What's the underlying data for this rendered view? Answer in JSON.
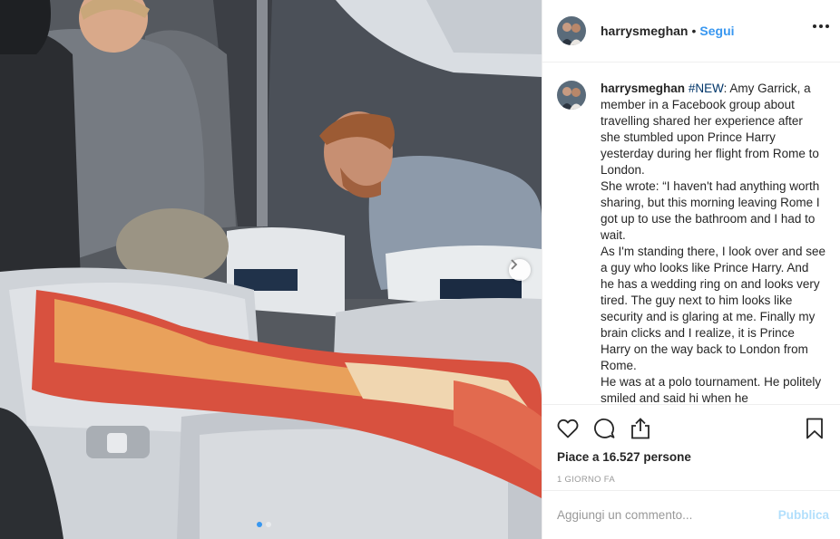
{
  "post": {
    "username": "harrysmeghan",
    "separator": "•",
    "follow_label": "Segui",
    "caption": {
      "username": "harrysmeghan",
      "hashtag": "#NEW",
      "lines": [
        ": Amy Garrick, a member in a Facebook group about travelling shared her experience after she stumbled upon Prince Harry yesterday during her flight from Rome to London.",
        "She wrote: “I haven't had anything worth sharing, but this morning leaving Rome I got up to use the bathroom and I had to wait.",
        "As I'm standing there, I look over and see a guy who looks like Prince Harry. And he has a wedding ring on and looks very tired. The guy next to him looks like security and is glaring at me. Finally my brain clicks and I realize, it is Prince Harry on the way back to London from Rome.",
        "He was at a polo tournament. He politely smiled and said hi when he"
      ]
    },
    "likes_text": "Piace a 16.527 persone",
    "time_ago": "1 GIORNO FA",
    "comment_placeholder": "Aggiungi un commento...",
    "publish_label": "Pubblica",
    "carousel": {
      "slides": 2,
      "current": 1
    }
  },
  "icons": {
    "more": "more-options-icon",
    "like": "heart-icon",
    "comment": "comment-icon",
    "share": "share-icon",
    "save": "bookmark-icon",
    "next": "chevron-right-icon"
  },
  "colors": {
    "link": "#3897f0",
    "publish_disabled": "#b2dffc",
    "text": "#262626",
    "muted": "#999999",
    "border": "#efefef"
  }
}
